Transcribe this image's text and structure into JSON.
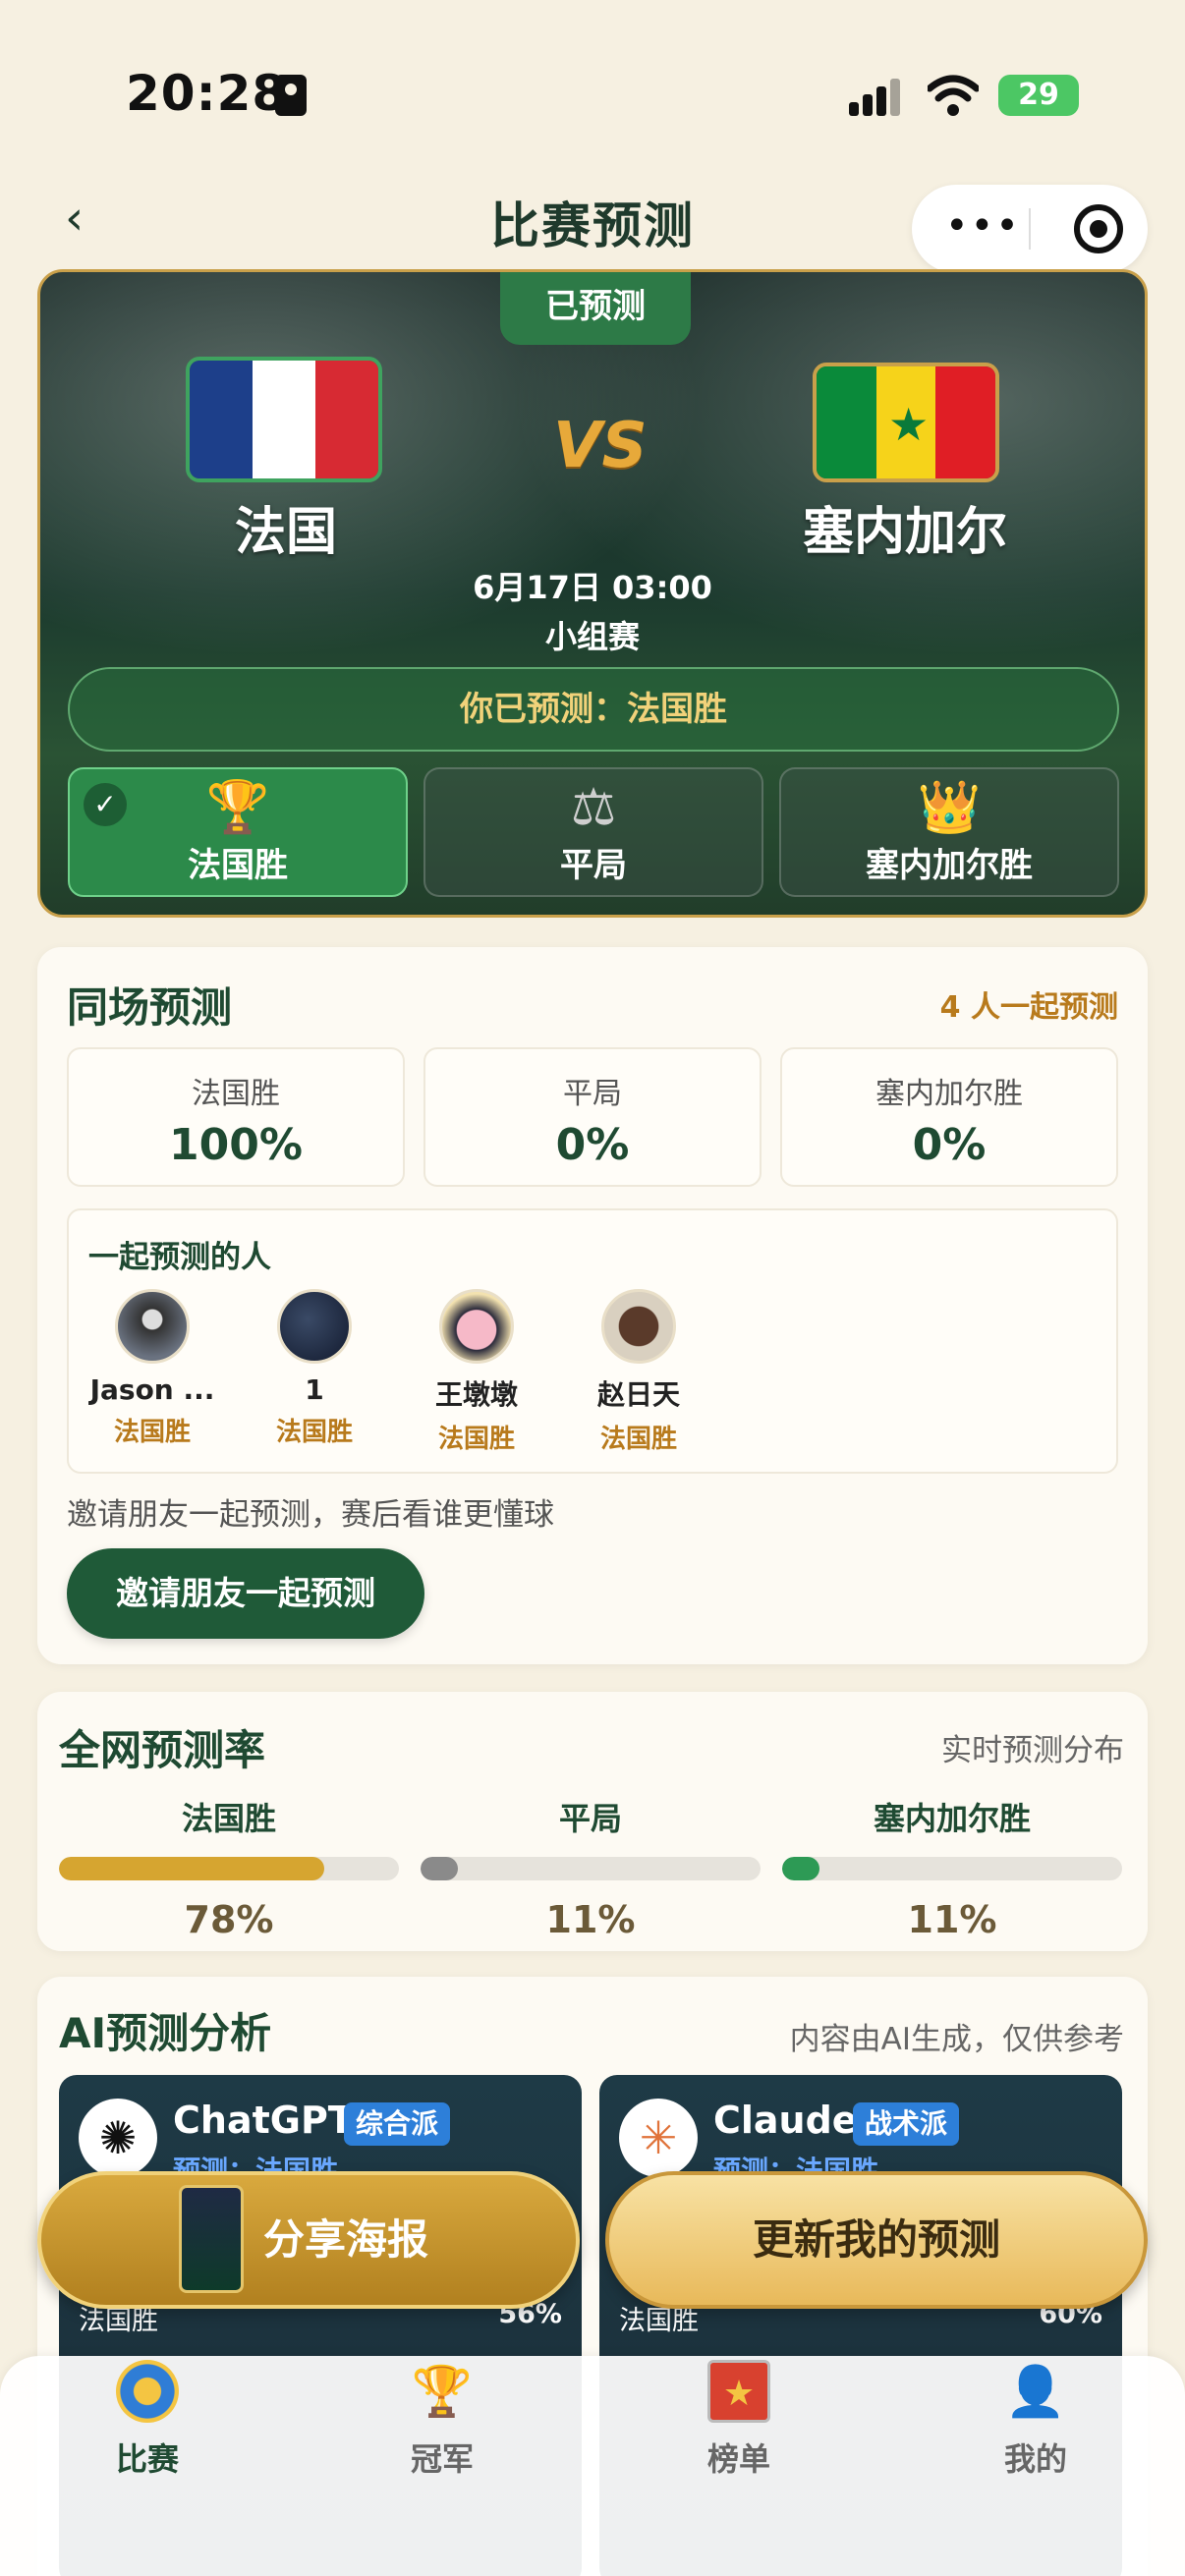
{
  "status_bar": {
    "time": "20:28",
    "battery": "29"
  },
  "nav": {
    "title": "比赛预测",
    "more": "•••"
  },
  "match": {
    "predicted_tag": "已预测",
    "home_team": "法国",
    "away_team": "塞内加尔",
    "vs": "VS",
    "datetime": "6月17日 03:00",
    "stage": "小组赛",
    "your_pick": "你已预测：法国胜",
    "options": [
      {
        "label": "法国胜",
        "icon": "trophy-icon",
        "selected": true
      },
      {
        "label": "平局",
        "icon": "scale-icon",
        "selected": false
      },
      {
        "label": "塞内加尔胜",
        "icon": "crown-icon",
        "selected": false
      }
    ]
  },
  "same_match": {
    "title": "同场预测",
    "count": "4 人一起预测",
    "stats": [
      {
        "label": "法国胜",
        "value": "100%"
      },
      {
        "label": "平局",
        "value": "0%"
      },
      {
        "label": "塞内加尔胜",
        "value": "0%"
      }
    ],
    "people_title": "一起预测的人",
    "people": [
      {
        "name": "Jason ...",
        "pick": "法国胜"
      },
      {
        "name": "1",
        "pick": "法国胜"
      },
      {
        "name": "王墩墩",
        "pick": "法国胜"
      },
      {
        "name": "赵日天",
        "pick": "法国胜"
      }
    ],
    "invite_text": "邀请朋友一起预测，赛后看谁更懂球",
    "invite_button": "邀请朋友一起预测"
  },
  "global_rate": {
    "title": "全网预测率",
    "subtitle": "实时预测分布",
    "rates": [
      {
        "label": "法国胜",
        "value": "78%",
        "fraction": 0.78,
        "color": "#d6a530"
      },
      {
        "label": "平局",
        "value": "11%",
        "fraction": 0.11,
        "color": "#8a8a8a"
      },
      {
        "label": "塞内加尔胜",
        "value": "11%",
        "fraction": 0.11,
        "color": "#2d9a55"
      }
    ]
  },
  "ai": {
    "title": "AI预测分析",
    "subtitle": "内容由AI生成，仅供参考",
    "models": [
      {
        "name": "ChatGPT",
        "tag": "综合派",
        "prediction": "预测：法国胜",
        "row_label": "法国胜",
        "row_value": "56%"
      },
      {
        "name": "Claude",
        "tag": "战术派",
        "prediction": "预测：法国胜",
        "row_label": "法国胜",
        "row_value": "60%"
      }
    ]
  },
  "actions": {
    "share": "分享海报",
    "update": "更新我的预测"
  },
  "tabbar": [
    {
      "label": "比赛",
      "icon": "soccer-ball-icon",
      "active": true
    },
    {
      "label": "冠军",
      "icon": "trophy-icon",
      "active": false
    },
    {
      "label": "榜单",
      "icon": "ranking-icon",
      "active": false
    },
    {
      "label": "我的",
      "icon": "user-icon",
      "active": false
    }
  ]
}
